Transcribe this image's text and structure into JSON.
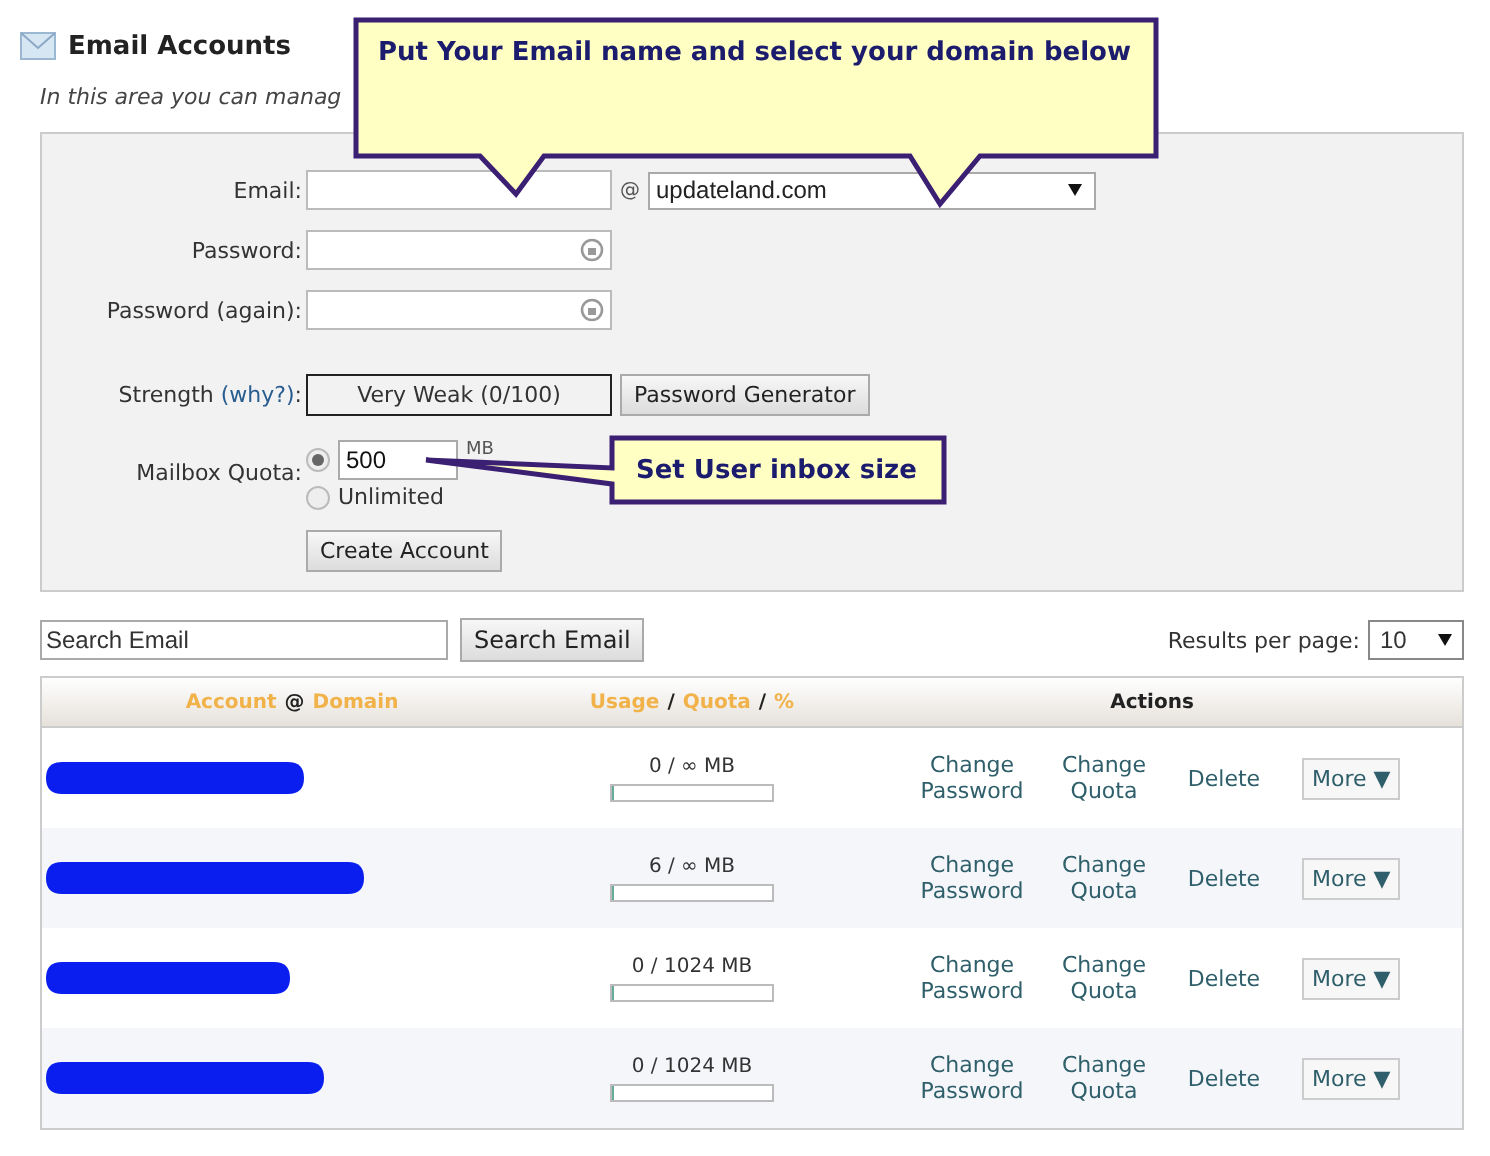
{
  "page": {
    "title": "Email Accounts",
    "description": "In this area you can manag"
  },
  "form": {
    "email_label": "Email:",
    "at": "@",
    "domain": "updateland.com",
    "password_label": "Password:",
    "password_again_label": "Password (again):",
    "strength_label": "Strength",
    "strength_link": "(why?)",
    "strength_colon": ":",
    "strength_value": "Very Weak (0/100)",
    "generator_button": "Password Generator",
    "quota_label": "Mailbox Quota:",
    "create_button": "Create Account",
    "quota_options": [
      {
        "kind": "value",
        "value": "500",
        "unit": "MB",
        "selected": true
      },
      {
        "kind": "unlimited",
        "label": "Unlimited",
        "selected": false
      }
    ]
  },
  "search": {
    "value": "Search Email",
    "button": "Search Email",
    "per_page_label": "Results per page:",
    "per_page": "10"
  },
  "table": {
    "columns": [
      {
        "parts": [
          {
            "text": "Account",
            "kind": "link"
          },
          {
            "text": "@",
            "kind": "plain"
          },
          {
            "text": "Domain",
            "kind": "link"
          }
        ]
      },
      {
        "parts": [
          {
            "text": "Usage",
            "kind": "link"
          },
          {
            "text": "/",
            "kind": "plain"
          },
          {
            "text": "Quota",
            "kind": "link"
          },
          {
            "text": "/",
            "kind": "plain"
          },
          {
            "text": "%",
            "kind": "link"
          }
        ]
      },
      {
        "parts": [
          {
            "text": "Actions",
            "kind": "plain"
          }
        ]
      }
    ],
    "rows": [
      {
        "usage": "0 / ∞ MB",
        "level": 0,
        "actions": [
          "Change Password",
          "Change Quota",
          "Delete"
        ],
        "more": "More ▼"
      },
      {
        "usage": "6 / ∞ MB",
        "level": 0,
        "actions": [
          "Change Password",
          "Change Quota",
          "Delete"
        ],
        "more": "More ▼"
      },
      {
        "usage": "0 / 1024 MB",
        "level": 0,
        "actions": [
          "Change Password",
          "Change Quota",
          "Delete"
        ],
        "more": "More ▼"
      },
      {
        "usage": "0 / 1024 MB",
        "level": 0,
        "actions": [
          "Change Password",
          "Change Quota",
          "Delete"
        ],
        "more": "More ▼"
      }
    ]
  },
  "callouts": [
    {
      "text": "Put Your Email name and select your domain below"
    },
    {
      "text": "Set User inbox size"
    }
  ]
}
